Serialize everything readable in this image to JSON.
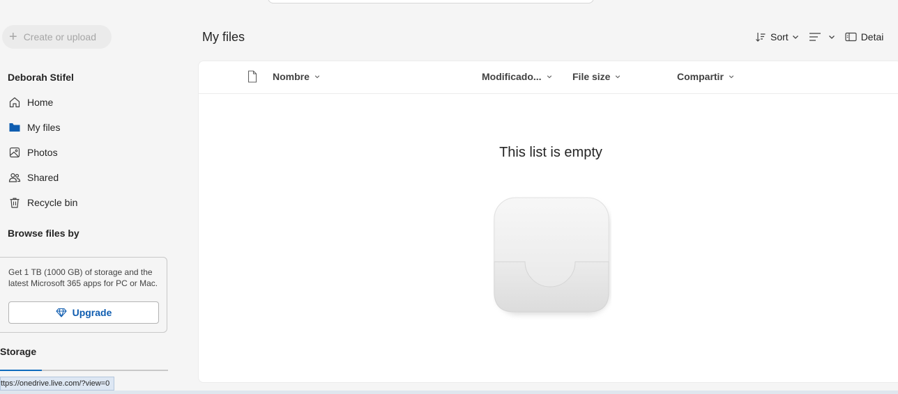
{
  "sidebar": {
    "create_label": "Create or upload",
    "user_name": "Deborah Stifel",
    "items": [
      {
        "label": "Home",
        "icon": "home-icon"
      },
      {
        "label": "My files",
        "icon": "folder-icon",
        "selected": true
      },
      {
        "label": "Photos",
        "icon": "photo-icon"
      },
      {
        "label": "Shared",
        "icon": "people-icon"
      },
      {
        "label": "Recycle bin",
        "icon": "trash-icon"
      }
    ],
    "browse_label": "Browse files by",
    "promo": {
      "text": "Get 1 TB (1000 GB) of storage and the latest Microsoft 365 apps for PC or Mac.",
      "button": "Upgrade"
    },
    "storage_label": "Storage",
    "storage_fraction": 0.25
  },
  "status_url": "ttps://onedrive.live.com/?view=0",
  "main": {
    "title": "My files",
    "toolbar": {
      "sort_label": "Sort",
      "details_label": "Detai"
    },
    "columns": {
      "name": "Nombre",
      "modified": "Modificado...",
      "size": "File size",
      "sharing": "Compartir"
    },
    "empty_title": "This list is empty"
  },
  "colors": {
    "accent": "#0f6cbd",
    "link": "#0f5db0",
    "background": "#f5f5f5"
  }
}
